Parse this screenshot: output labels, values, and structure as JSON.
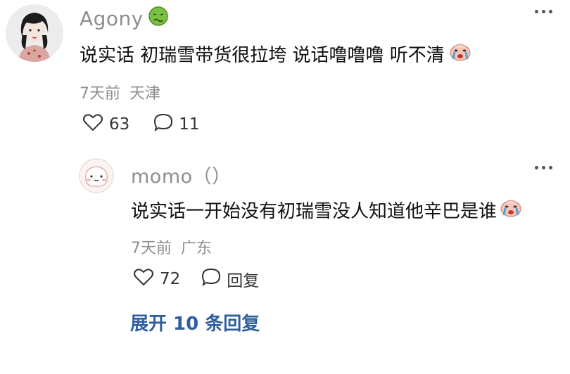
{
  "comment": {
    "username": "Agony",
    "text": "说实话 初瑞雪带货很拉垮 说话噜噜噜 听不清",
    "time": "7天前",
    "location": "天津",
    "likes": "63",
    "replies_count": "11"
  },
  "reply": {
    "username": "momo（）",
    "text": "说实话一开始没有初瑞雪没人知道他辛巴是谁",
    "time": "7天前",
    "location": "广东",
    "likes": "72",
    "reply_label": "回复"
  },
  "expand_label": "展开 10 条回复",
  "colors": {
    "username": "#8e8e8e",
    "meta": "#8f8f8f",
    "link": "#2f5e9e",
    "sick_emoji": "#7bc043"
  },
  "icons": [
    "more-icon",
    "sick-face-emoji",
    "crying-face-emoji",
    "heart-icon",
    "comment-bubble-icon"
  ]
}
